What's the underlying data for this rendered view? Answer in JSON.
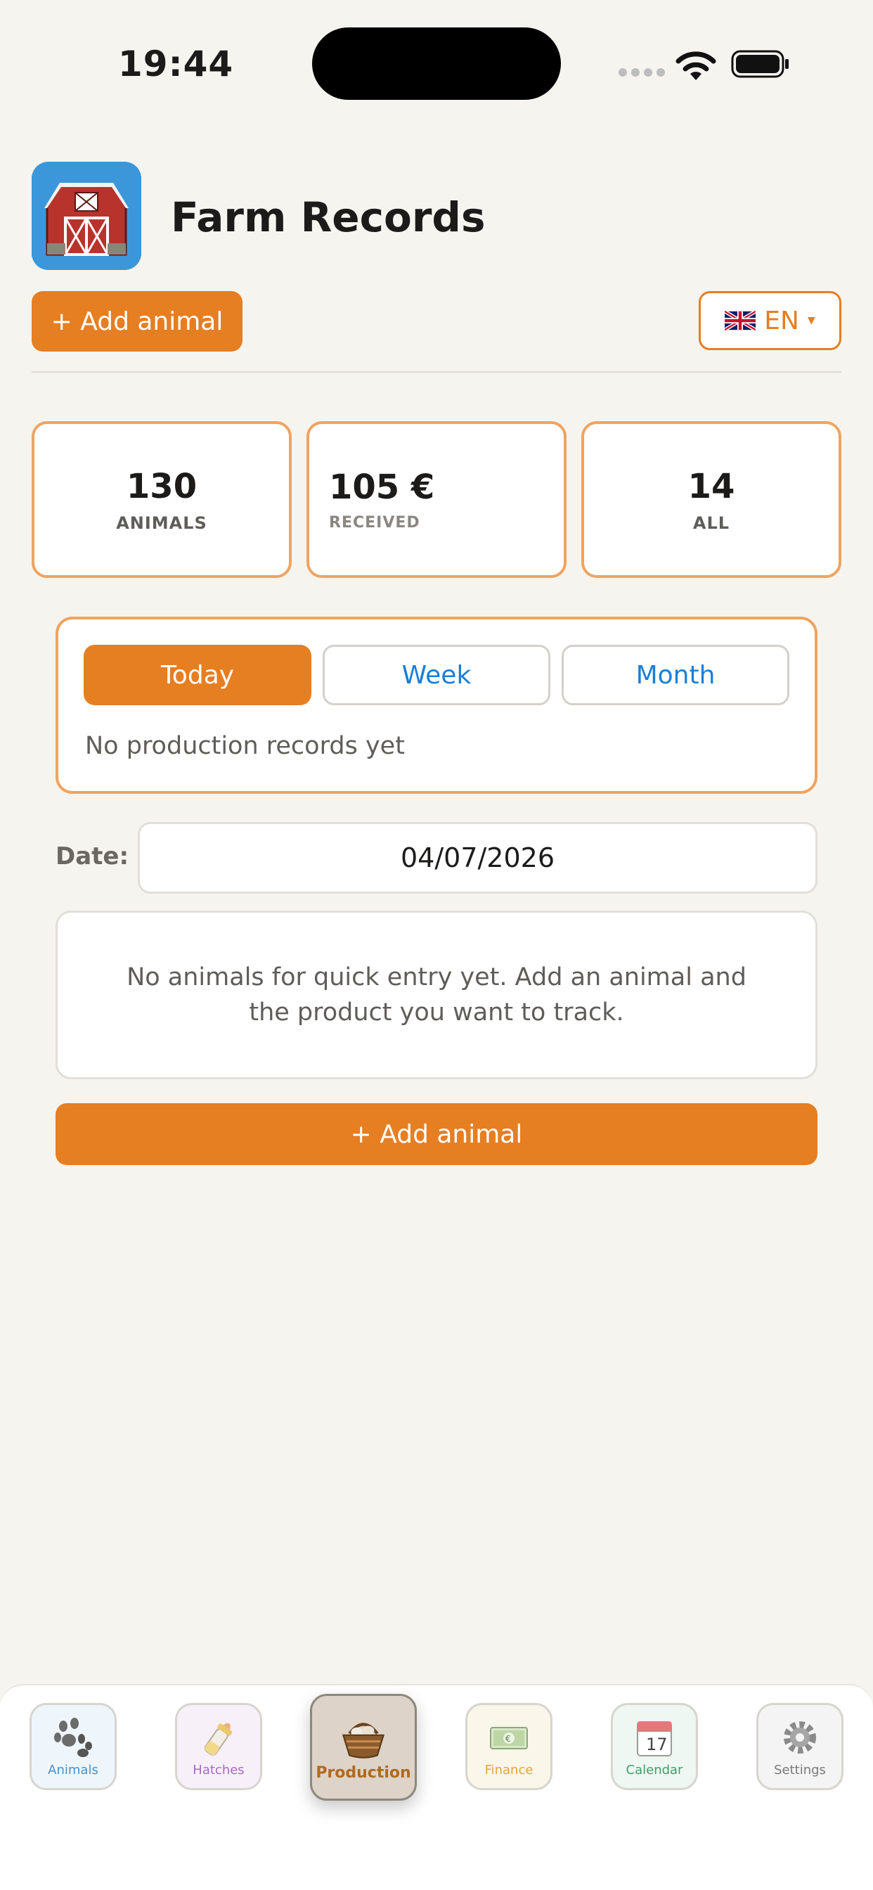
{
  "status_bar": {
    "time": "19:44"
  },
  "header": {
    "title": "Farm Records",
    "add_button": "+ Add animal",
    "language": "EN"
  },
  "stats": [
    {
      "value": "130",
      "label": "ANIMALS"
    },
    {
      "value": "105 €",
      "label": "RECEIVED"
    },
    {
      "value": "14",
      "label": "ALL"
    }
  ],
  "production": {
    "tabs": [
      "Today",
      "Week",
      "Month"
    ],
    "active_tab": "Today",
    "empty_message": "No production records yet"
  },
  "date_row": {
    "label": "Date:",
    "value": "04/07/2026"
  },
  "quick_entry": {
    "empty_message": "No animals for quick entry yet. Add an animal and the product you want to track."
  },
  "add_animal_button": "+ Add animal",
  "bottom_nav": [
    {
      "label": "Animals",
      "icon": "paw-icon",
      "color": "#4a90c8"
    },
    {
      "label": "Hatches",
      "icon": "baby-bottle-icon",
      "color": "#a56cc1"
    },
    {
      "label": "Production",
      "icon": "basket-icon",
      "color": "#b06a20",
      "active": true
    },
    {
      "label": "Finance",
      "icon": "money-icon",
      "color": "#e0a53a"
    },
    {
      "label": "Calendar",
      "icon": "calendar-icon",
      "color": "#3f9f6a"
    },
    {
      "label": "Settings",
      "icon": "gear-icon",
      "color": "#7a7a7a"
    }
  ],
  "colors": {
    "accent": "#e67e22",
    "card_border": "#efa460",
    "link": "#1a7fd4",
    "background": "#f6f4ef"
  }
}
